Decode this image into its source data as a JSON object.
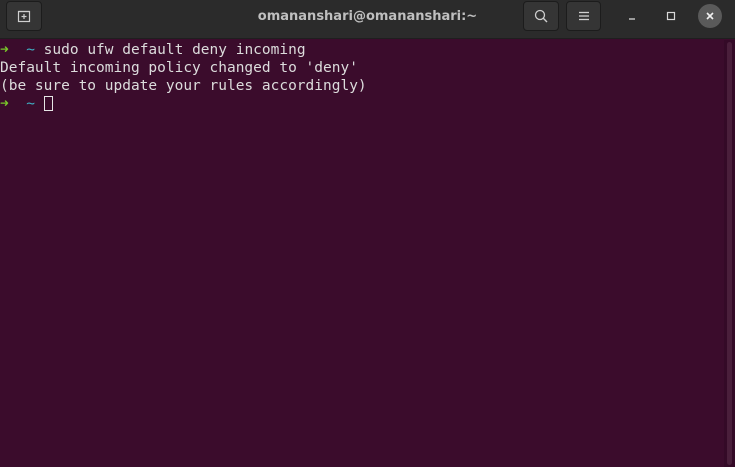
{
  "window": {
    "title": "omananshari@omananshari:~"
  },
  "titlebar": {
    "new_tab_icon": "new-tab-icon",
    "search_icon": "search-icon",
    "menu_icon": "hamburger-menu-icon",
    "minimize_icon": "minimize-icon",
    "maximize_icon": "maximize-icon",
    "close_icon": "close-icon"
  },
  "terminal": {
    "prompt_arrow": "➜",
    "prompt_dir": "~",
    "lines": [
      {
        "type": "command",
        "text": "sudo ufw default deny incoming"
      },
      {
        "type": "output",
        "text": "Default incoming policy changed to 'deny'"
      },
      {
        "type": "output",
        "text": "(be sure to update your rules accordingly)"
      },
      {
        "type": "prompt",
        "text": ""
      }
    ]
  },
  "colors": {
    "background": "#3b0c2c",
    "titlebar": "#2b2b2b",
    "prompt_arrow": "#79c72a",
    "prompt_dir": "#3fb0c4",
    "text": "#dcdcdc"
  }
}
